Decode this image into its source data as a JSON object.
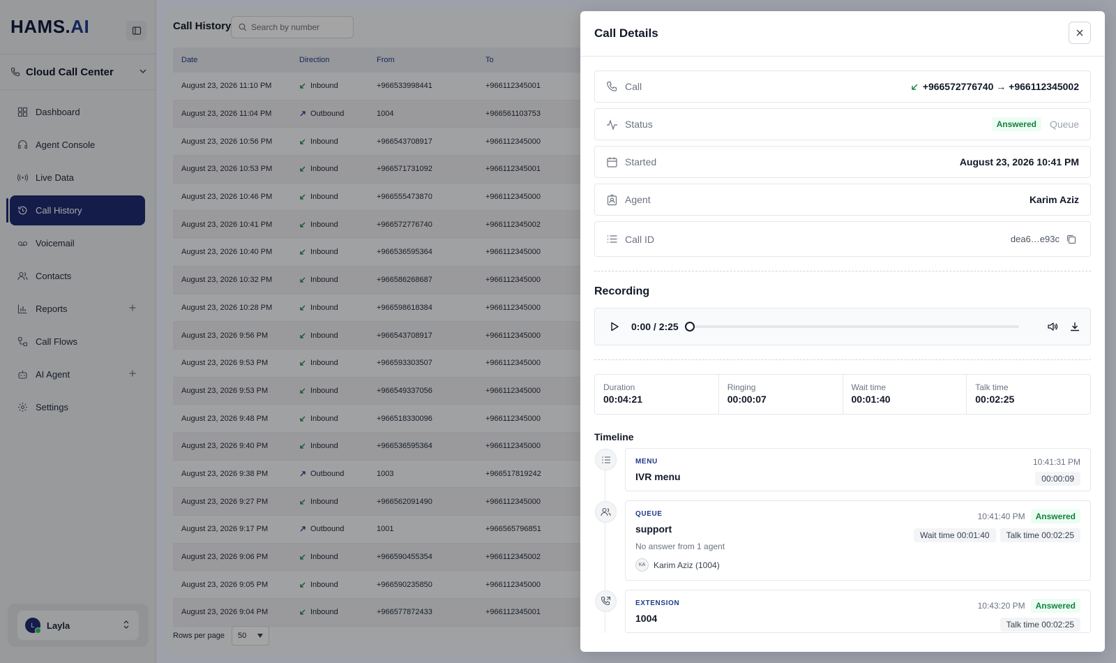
{
  "brand": {
    "name_part1": "HAMS.",
    "name_part2": "AI"
  },
  "workspace": {
    "label": "Cloud Call Center"
  },
  "sidebar": {
    "items": [
      {
        "label": "Dashboard"
      },
      {
        "label": "Agent Console"
      },
      {
        "label": "Live Data"
      },
      {
        "label": "Call History"
      },
      {
        "label": "Voicemail"
      },
      {
        "label": "Contacts"
      },
      {
        "label": "Reports"
      },
      {
        "label": "Call Flows"
      },
      {
        "label": "AI Agent"
      },
      {
        "label": "Settings"
      }
    ]
  },
  "user": {
    "initial": "L",
    "name": "Layla"
  },
  "history": {
    "title": "Call History",
    "search_placeholder": "Search by number",
    "columns": {
      "date": "Date",
      "direction": "Direction",
      "from": "From",
      "to": "To"
    },
    "rows": [
      {
        "date": "August 23, 2026 11:10 PM",
        "direction": "Inbound",
        "from": "+966533998441",
        "to": "+966112345001"
      },
      {
        "date": "August 23, 2026 11:04 PM",
        "direction": "Outbound",
        "from": "1004",
        "to": "+966561103753"
      },
      {
        "date": "August 23, 2026 10:56 PM",
        "direction": "Inbound",
        "from": "+966543708917",
        "to": "+966112345000"
      },
      {
        "date": "August 23, 2026 10:53 PM",
        "direction": "Inbound",
        "from": "+966571731092",
        "to": "+966112345001"
      },
      {
        "date": "August 23, 2026 10:46 PM",
        "direction": "Inbound",
        "from": "+966555473870",
        "to": "+966112345000"
      },
      {
        "date": "August 23, 2026 10:41 PM",
        "direction": "Inbound",
        "from": "+966572776740",
        "to": "+966112345002"
      },
      {
        "date": "August 23, 2026 10:40 PM",
        "direction": "Inbound",
        "from": "+966536595364",
        "to": "+966112345000"
      },
      {
        "date": "August 23, 2026 10:32 PM",
        "direction": "Inbound",
        "from": "+966586268687",
        "to": "+966112345000"
      },
      {
        "date": "August 23, 2026 10:28 PM",
        "direction": "Inbound",
        "from": "+966598618384",
        "to": "+966112345000"
      },
      {
        "date": "August 23, 2026 9:56 PM",
        "direction": "Inbound",
        "from": "+966543708917",
        "to": "+966112345000"
      },
      {
        "date": "August 23, 2026 9:53 PM",
        "direction": "Inbound",
        "from": "+966593303507",
        "to": "+966112345000"
      },
      {
        "date": "August 23, 2026 9:53 PM",
        "direction": "Inbound",
        "from": "+966549337056",
        "to": "+966112345000"
      },
      {
        "date": "August 23, 2026 9:48 PM",
        "direction": "Inbound",
        "from": "+966518330096",
        "to": "+966112345000"
      },
      {
        "date": "August 23, 2026 9:40 PM",
        "direction": "Inbound",
        "from": "+966536595364",
        "to": "+966112345000"
      },
      {
        "date": "August 23, 2026 9:38 PM",
        "direction": "Outbound",
        "from": "1003",
        "to": "+966517819242"
      },
      {
        "date": "August 23, 2026 9:27 PM",
        "direction": "Inbound",
        "from": "+966562091490",
        "to": "+966112345000"
      },
      {
        "date": "August 23, 2026 9:17 PM",
        "direction": "Outbound",
        "from": "1001",
        "to": "+966565796851"
      },
      {
        "date": "August 23, 2026 9:06 PM",
        "direction": "Inbound",
        "from": "+966590455354",
        "to": "+966112345002"
      },
      {
        "date": "August 23, 2026 9:05 PM",
        "direction": "Inbound",
        "from": "+966590235850",
        "to": "+966112345000"
      },
      {
        "date": "August 23, 2026 9:04 PM",
        "direction": "Inbound",
        "from": "+966577872433",
        "to": "+966112345001"
      }
    ],
    "rows_per_page_label": "Rows per page",
    "rows_per_page_value": "50"
  },
  "details": {
    "title": "Call Details",
    "call": {
      "label": "Call",
      "value": "+966572776740 → +966112345002"
    },
    "status": {
      "label": "Status",
      "answered": "Answered",
      "queue": "Queue"
    },
    "started": {
      "label": "Started",
      "value": "August 23, 2026 10:41 PM"
    },
    "agent": {
      "label": "Agent",
      "value": "Karim Aziz"
    },
    "call_id": {
      "label": "Call ID",
      "value": "dea6…e93c"
    },
    "recording": {
      "title": "Recording",
      "time": "0:00 / 2:25",
      "progress": 0
    },
    "stats": [
      {
        "label": "Duration",
        "value": "00:04:21"
      },
      {
        "label": "Ringing",
        "value": "00:00:07"
      },
      {
        "label": "Wait time",
        "value": "00:01:40"
      },
      {
        "label": "Talk time",
        "value": "00:02:25"
      }
    ],
    "timeline_title": "Timeline",
    "timeline": [
      {
        "kind": "MENU",
        "name": "IVR menu",
        "time": "10:41:31 PM",
        "chip": "00:00:09"
      },
      {
        "kind": "QUEUE",
        "name": "support",
        "time": "10:41:40 PM",
        "status": "Answered",
        "chip_wait": "Wait time 00:01:40",
        "chip_talk": "Talk time 00:02:25",
        "sub": "No answer from 1 agent",
        "agent_initials": "KA",
        "agent_name": "Karim Aziz (1004)"
      },
      {
        "kind": "EXTENSION",
        "name": "1004",
        "time": "10:43:20 PM",
        "status": "Answered",
        "chip_talk": "Talk time 00:02:25"
      }
    ]
  },
  "colors": {
    "primary": "#1e2a6e",
    "success": "#15803d",
    "overlay": "#9ea1aa"
  }
}
